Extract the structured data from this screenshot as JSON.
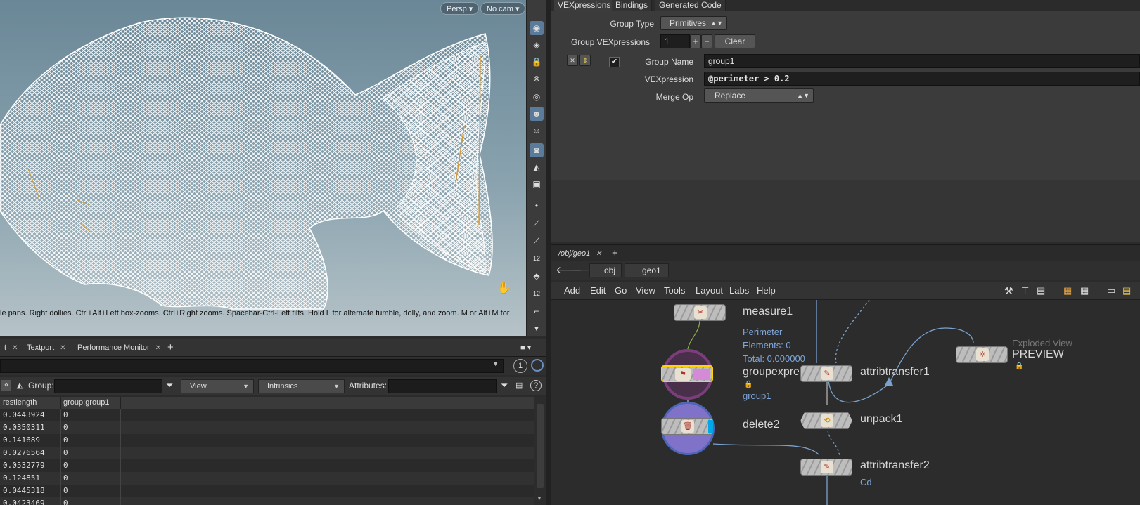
{
  "viewport": {
    "persp_label": "Persp",
    "cam_label": "No cam",
    "hint": "le pans. Right dollies. Ctrl+Alt+Left box-zooms. Ctrl+Right zooms. Spacebar-Ctrl-Left tilts. Hold L for alternate tumble, dolly, and zoom. M or Alt+M for",
    "toolbar_icons": [
      "display-options-icon",
      "geometry-icon",
      "lock-icon",
      "snap-icon",
      "visibility-icon",
      "shading-icon",
      "ghost-icon",
      "camera-icon",
      "template-icon",
      "render-icon",
      "point-icon",
      "normal-icon",
      "pin-icon",
      "numbers-icon",
      "select-icon",
      "prim-numbers-icon",
      "edge-icon"
    ],
    "tool_numbers": [
      "12",
      "12"
    ]
  },
  "spreadsheet": {
    "tabs": [
      {
        "label": "t"
      },
      {
        "label": "Textport"
      },
      {
        "label": "Performance Monitor"
      }
    ],
    "add_tab": "+",
    "pin_label": "1",
    "group_label": "Group:",
    "view_label": "View",
    "intrinsics_label": "Intrinsics",
    "attributes_label": "Attributes:",
    "help": "?",
    "columns": [
      "restlength",
      "group:group1"
    ],
    "rows": [
      [
        "0.0443924",
        "0"
      ],
      [
        "0.0350311",
        "0"
      ],
      [
        "0.141689",
        "0"
      ],
      [
        "0.0276564",
        "0"
      ],
      [
        "0.0532779",
        "0"
      ],
      [
        "0.124851",
        "0"
      ],
      [
        "0.0445318",
        "0"
      ],
      [
        "0.0423469",
        "0"
      ]
    ]
  },
  "params": {
    "tabs": [
      "VEXpressions",
      "Bindings",
      "Generated Code"
    ],
    "group_type_label": "Group Type",
    "group_type_value": "Primitives",
    "group_vexpressions_label": "Group VEXpressions",
    "group_vexpressions_count": "1",
    "plus": "+",
    "minus": "−",
    "clear_label": "Clear",
    "group_name_label": "Group Name",
    "group_name_value": "group1",
    "vexpression_label": "VEXpression",
    "vexpression_value": "@perimeter > 0.2",
    "merge_op_label": "Merge Op",
    "merge_op_value": "Replace"
  },
  "network": {
    "tab_label": "/obj/geo1",
    "add_tab": "+",
    "path": [
      "obj",
      "geo1"
    ],
    "menu": [
      "Add",
      "Edit",
      "Go",
      "View",
      "Tools",
      "Layout",
      "Labs",
      "Help"
    ],
    "nodes": {
      "measure": {
        "name": "measure1",
        "info": [
          "Perimeter",
          "Elements: 0",
          "Total: 0.000000"
        ]
      },
      "groupexpr": {
        "name": "groupexpre",
        "info": [
          "group1"
        ]
      },
      "delete": {
        "name": "delete2"
      },
      "attribtransfer1": {
        "name": "attribtransfer1"
      },
      "unpack": {
        "name": "unpack1"
      },
      "attribtransfer2": {
        "name": "attribtransfer2",
        "info": [
          "Cd"
        ]
      },
      "preview": {
        "name": "PREVIEW",
        "comment": "Exploded View"
      }
    },
    "colors": {
      "wire": "#7aa2cf",
      "selected": "#ffd400",
      "group_ring": "#7a3f7a",
      "delete_ring": "#5a6fc8"
    }
  }
}
